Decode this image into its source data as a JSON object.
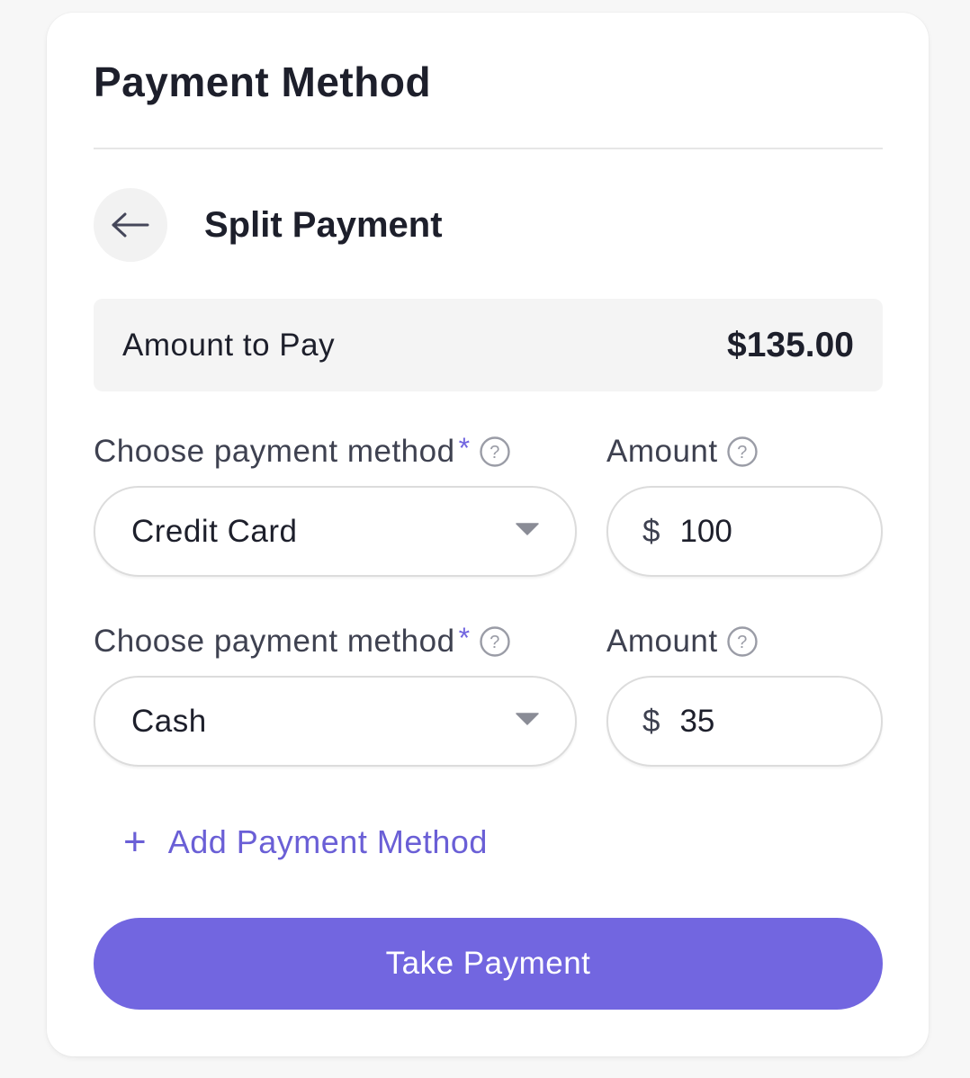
{
  "card": {
    "title": "Payment Method"
  },
  "split": {
    "title": "Split Payment",
    "back_icon": "arrow-left-icon"
  },
  "summary": {
    "label": "Amount to Pay",
    "value": "$135.00"
  },
  "payments": [
    {
      "method_label": "Choose payment method",
      "required_mark": "*",
      "method_value": "Credit Card",
      "amount_label": "Amount",
      "currency": "$",
      "amount_value": "100"
    },
    {
      "method_label": "Choose payment method",
      "required_mark": "*",
      "method_value": "Cash",
      "amount_label": "Amount",
      "currency": "$",
      "amount_value": "35"
    }
  ],
  "actions": {
    "add_icon": "+",
    "add_label": "Add Payment Method",
    "submit_label": "Take Payment"
  },
  "colors": {
    "accent": "#7266e0",
    "link": "#6a5fd6",
    "summary_bg": "#f4f4f4",
    "text": "#1d1f2b"
  }
}
